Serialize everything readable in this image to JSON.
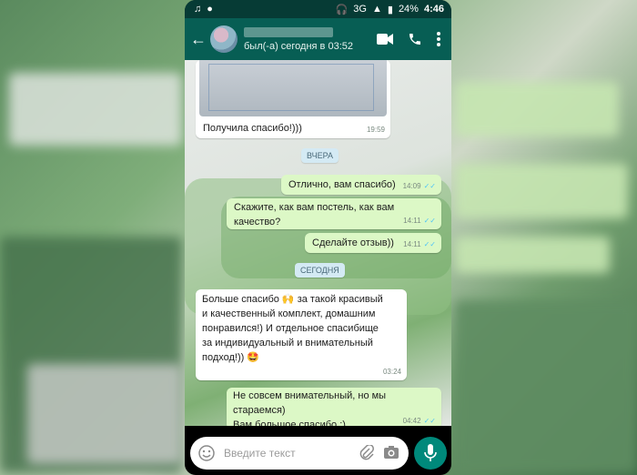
{
  "status_bar": {
    "network": "3G",
    "battery": "24%",
    "time": "4:46"
  },
  "header": {
    "last_seen": "был(-а) сегодня в 03:52",
    "icons": [
      "back-arrow-icon",
      "video-call-icon",
      "phone-icon",
      "more-vert-icon"
    ]
  },
  "messages": [
    {
      "type": "in",
      "text": "Получила спасибо!)))",
      "time": "19:59",
      "has_image": true
    },
    {
      "type": "day",
      "text": "ВЧЕРА"
    },
    {
      "type": "out",
      "text": "Отлично, вам спасибо)",
      "time": "14:09"
    },
    {
      "type": "out",
      "text": "Скажите, как вам постель, как вам качество?",
      "time": "14:11"
    },
    {
      "type": "out",
      "text": "Сделайте отзыв))",
      "time": "14:11"
    },
    {
      "type": "day",
      "text": "СЕГОДНЯ"
    },
    {
      "type": "in",
      "text": "Больше спасибо 🙌 за такой красивый и качественный комплект, домашним понравился!)  И отдельное спасибище за индивидуальный и внимательный подход!)) 🤩",
      "time": "03:24"
    },
    {
      "type": "out",
      "text": "Не совсем внимательный, но мы стараемся)\nВам большое спасибо :)",
      "time": "04:42"
    }
  ],
  "input": {
    "placeholder": "Введите текст"
  },
  "colors": {
    "appbar": "#075e54",
    "statusbar": "#063b35",
    "outgoing_bubble": "#dcf8c6",
    "incoming_bubble": "#ffffff",
    "mic_button": "#00897b",
    "read_ticks": "#4fc3f7"
  }
}
